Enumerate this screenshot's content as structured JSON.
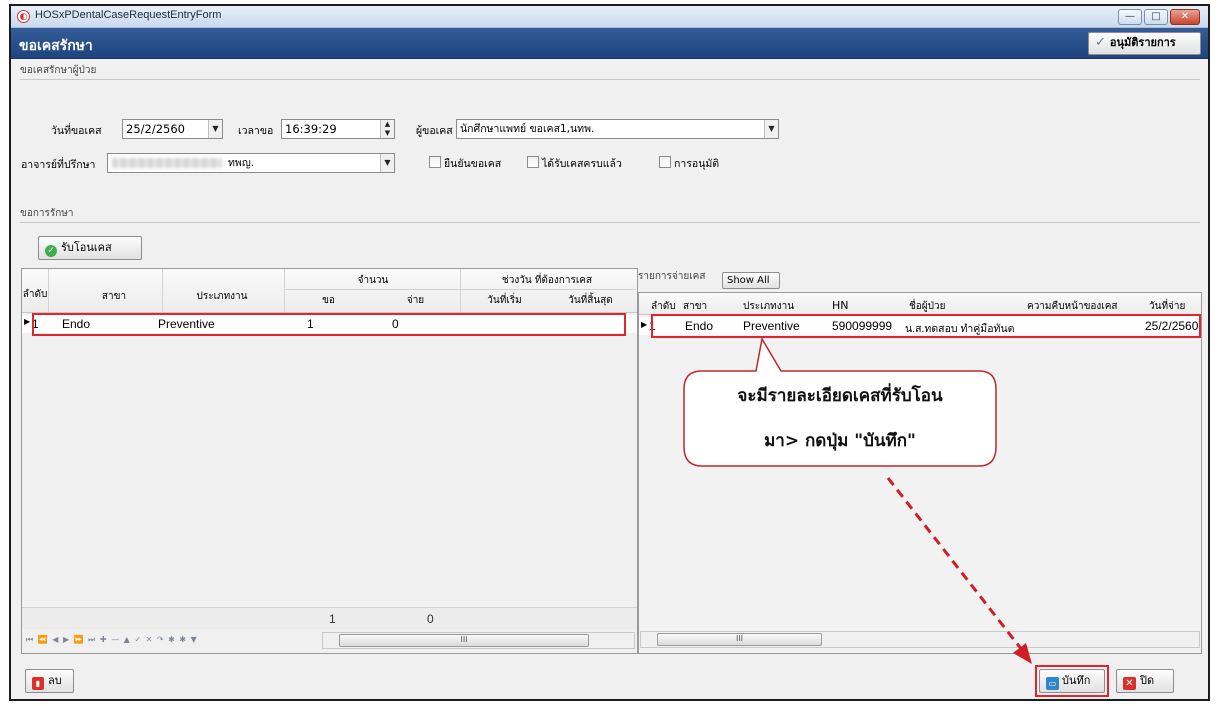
{
  "window": {
    "title": "HOSxPDentalCaseRequestEntryForm",
    "min_label": "—",
    "max_label": "□",
    "close_label": "✕"
  },
  "header": {
    "title": "ขอเคสรักษา",
    "approve_label": "อนุมัติรายการ"
  },
  "request_section": {
    "label": "ขอเคสรักษาผู้ป่วย",
    "date_label": "วันที่ขอเคส",
    "date_value": "25/2/2560",
    "time_label": "เวลาขอ",
    "time_value": "16:39:29",
    "requester_label": "ผู้ขอเคส",
    "requester_value": "นักศึกษาแพทย์ ขอเคส1,นทพ.",
    "advisor_label": "อาจารย์ที่ปรึกษา",
    "advisor_value": "ทพญ.",
    "confirm_label": "ยืนยันขอเคส",
    "received_label": "ได้รับเคสครบแล้ว",
    "approval_label": "การอนุมัติ"
  },
  "treatment_section": {
    "label": "ขอการรักษา",
    "receive_button_label": "รับโอนเคส"
  },
  "left_grid": {
    "headers": {
      "order": "ลำดับ",
      "branch": "สาขา",
      "work_type": "ประเภทงาน",
      "amount": "จำนวน",
      "amount_request": "ขอ",
      "amount_pay": "จ่าย",
      "period": "ช่วงวัน ที่ต้องการเคส",
      "start_date": "วันที่เริ่ม",
      "end_date": "วันที่สิ้นสุด"
    },
    "rows": [
      {
        "order": "1",
        "branch": "Endo",
        "work_type": "Preventive",
        "request": "1",
        "pay": "0",
        "start": "",
        "end": ""
      }
    ],
    "footer_request_total": "1",
    "footer_pay_total": "0",
    "nav_glyphs": "⏮ ⏪ ◀ ▶ ⏩ ⏭ ✚ — ▲ ✓ ✕ ↷ ✱ ✱ ▼",
    "scroll_thumb": "III"
  },
  "right_grid": {
    "label": "รายการจ่ายเคส",
    "show_all_label": "Show All",
    "headers": {
      "order": "ลำดับ",
      "branch": "สาขา",
      "work_type": "ประเภทงาน",
      "hn": "HN",
      "patient_name": "ชื่อผู้ป่วย",
      "progress": "ความคืบหน้าของเคส",
      "pay_date": "วันที่จ่าย"
    },
    "rows": [
      {
        "order": "1",
        "branch": "Endo",
        "work_type": "Preventive",
        "hn": "590099999",
        "patient_name": "น.ส.ทดสอบ ทำคู่มือทันต",
        "progress": "",
        "pay_date": "25/2/2560"
      }
    ],
    "scroll_thumb": "III"
  },
  "callout": {
    "line1": "จะมีรายละเอียดเคสที่รับโอน",
    "line2": "มา> กดปุ่ม \"บันทึก\""
  },
  "footer": {
    "delete_label": "ลบ",
    "save_label": "บันทึก",
    "close_label": "ปิด"
  },
  "colors": {
    "header_bg": "#1f437f",
    "annotation_red": "#e3242b",
    "selection_row": "#ffffff"
  }
}
